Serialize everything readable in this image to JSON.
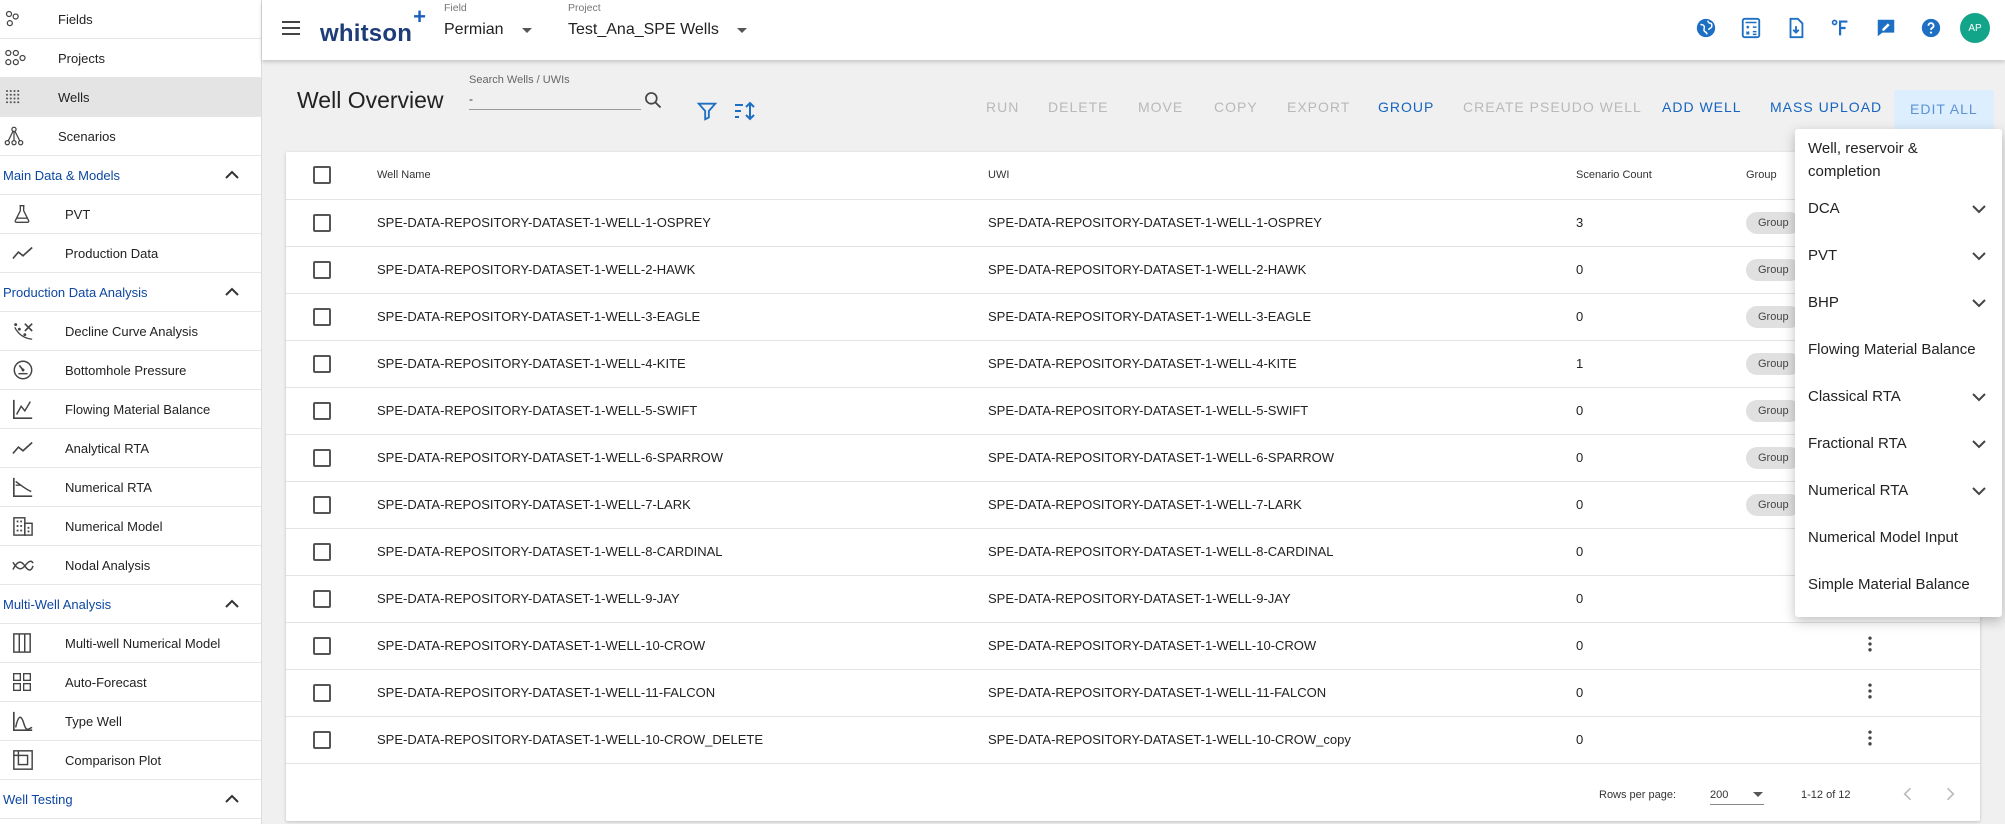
{
  "sidebar": {
    "top_items": [
      {
        "label": "Fields",
        "icon": "fields-icon"
      },
      {
        "label": "Projects",
        "icon": "projects-icon"
      },
      {
        "label": "Wells",
        "icon": "wells-icon",
        "active": true
      },
      {
        "label": "Scenarios",
        "icon": "scenarios-icon"
      }
    ],
    "sections": [
      {
        "title": "Main Data & Models",
        "items": [
          {
            "label": "PVT",
            "icon": "flask-icon"
          },
          {
            "label": "Production Data",
            "icon": "trend-line-icon"
          }
        ]
      },
      {
        "title": "Production Data Analysis",
        "items": [
          {
            "label": "Decline Curve Analysis",
            "icon": "decline-curve-icon"
          },
          {
            "label": "Bottomhole Pressure",
            "icon": "gauge-icon"
          },
          {
            "label": "Flowing Material Balance",
            "icon": "chart-icon"
          },
          {
            "label": "Analytical RTA",
            "icon": "trend-line-icon"
          },
          {
            "label": "Numerical RTA",
            "icon": "numerical-rta-icon"
          },
          {
            "label": "Numerical Model",
            "icon": "building-icon"
          },
          {
            "label": "Nodal Analysis",
            "icon": "nodal-icon"
          }
        ]
      },
      {
        "title": "Multi-Well Analysis",
        "items": [
          {
            "label": "Multi-well Numerical Model",
            "icon": "columns-icon"
          },
          {
            "label": "Auto-Forecast",
            "icon": "grid-icon"
          },
          {
            "label": "Type Well",
            "icon": "type-well-icon"
          },
          {
            "label": "Comparison Plot",
            "icon": "comparison-icon"
          }
        ]
      },
      {
        "title": "Well Testing",
        "items": []
      }
    ]
  },
  "topbar": {
    "brand": "whitson",
    "brand_plus": "+",
    "field_caption": "Field",
    "field_value": "Permian",
    "project_caption": "Project",
    "project_value": "Test_Ana_SPE Wells",
    "avatar_initials": "AP",
    "icons": [
      "globe-icon",
      "calculator-icon",
      "download-file-icon",
      "fahrenheit-icon",
      "feedback-icon",
      "help-icon"
    ]
  },
  "main": {
    "title": "Well Overview",
    "search_caption": "Search Wells / UWIs",
    "search_value": "-",
    "actions": [
      {
        "label": "RUN",
        "enabled": false
      },
      {
        "label": "DELETE",
        "enabled": false
      },
      {
        "label": "MOVE",
        "enabled": false
      },
      {
        "label": "COPY",
        "enabled": false
      },
      {
        "label": "EXPORT",
        "enabled": false
      },
      {
        "label": "GROUP",
        "enabled": true
      },
      {
        "label": "CREATE PSEUDO WELL",
        "enabled": false
      },
      {
        "label": "ADD WELL",
        "enabled": true
      },
      {
        "label": "MASS UPLOAD",
        "enabled": true
      },
      {
        "label": "EDIT ALL",
        "enabled": true
      }
    ]
  },
  "table": {
    "headers": {
      "name": "Well Name",
      "uwi": "UWI",
      "count": "Scenario Count",
      "group": "Group"
    },
    "rows": [
      {
        "name": "SPE-DATA-REPOSITORY-DATASET-1-WELL-1-OSPREY",
        "uwi": "SPE-DATA-REPOSITORY-DATASET-1-WELL-1-OSPREY",
        "count": "3",
        "group": "Group"
      },
      {
        "name": "SPE-DATA-REPOSITORY-DATASET-1-WELL-2-HAWK",
        "uwi": "SPE-DATA-REPOSITORY-DATASET-1-WELL-2-HAWK",
        "count": "0",
        "group": "Group"
      },
      {
        "name": "SPE-DATA-REPOSITORY-DATASET-1-WELL-3-EAGLE",
        "uwi": "SPE-DATA-REPOSITORY-DATASET-1-WELL-3-EAGLE",
        "count": "0",
        "group": "Group"
      },
      {
        "name": "SPE-DATA-REPOSITORY-DATASET-1-WELL-4-KITE",
        "uwi": "SPE-DATA-REPOSITORY-DATASET-1-WELL-4-KITE",
        "count": "1",
        "group": "Group"
      },
      {
        "name": "SPE-DATA-REPOSITORY-DATASET-1-WELL-5-SWIFT",
        "uwi": "SPE-DATA-REPOSITORY-DATASET-1-WELL-5-SWIFT",
        "count": "0",
        "group": "Group"
      },
      {
        "name": "SPE-DATA-REPOSITORY-DATASET-1-WELL-6-SPARROW",
        "uwi": "SPE-DATA-REPOSITORY-DATASET-1-WELL-6-SPARROW",
        "count": "0",
        "group": "Group"
      },
      {
        "name": "SPE-DATA-REPOSITORY-DATASET-1-WELL-7-LARK",
        "uwi": "SPE-DATA-REPOSITORY-DATASET-1-WELL-7-LARK",
        "count": "0",
        "group": "Group"
      },
      {
        "name": "SPE-DATA-REPOSITORY-DATASET-1-WELL-8-CARDINAL",
        "uwi": "SPE-DATA-REPOSITORY-DATASET-1-WELL-8-CARDINAL",
        "count": "0",
        "group": ""
      },
      {
        "name": "SPE-DATA-REPOSITORY-DATASET-1-WELL-9-JAY",
        "uwi": "SPE-DATA-REPOSITORY-DATASET-1-WELL-9-JAY",
        "count": "0",
        "group": ""
      },
      {
        "name": "SPE-DATA-REPOSITORY-DATASET-1-WELL-10-CROW",
        "uwi": "SPE-DATA-REPOSITORY-DATASET-1-WELL-10-CROW",
        "count": "0",
        "group": "",
        "menu": true
      },
      {
        "name": "SPE-DATA-REPOSITORY-DATASET-1-WELL-11-FALCON",
        "uwi": "SPE-DATA-REPOSITORY-DATASET-1-WELL-11-FALCON",
        "count": "0",
        "group": "",
        "menu": true
      },
      {
        "name": "SPE-DATA-REPOSITORY-DATASET-1-WELL-10-CROW_DELETE",
        "uwi": "SPE-DATA-REPOSITORY-DATASET-1-WELL-10-CROW_copy",
        "count": "0",
        "group": "",
        "menu": true
      }
    ]
  },
  "pager": {
    "rows_per_page_label": "Rows per page:",
    "rows_per_page_value": "200",
    "range": "1-12 of 12"
  },
  "dropdown": {
    "items": [
      {
        "label": "Well, reservoir & completion",
        "expandable": false
      },
      {
        "label": "DCA",
        "expandable": true
      },
      {
        "label": "PVT",
        "expandable": true
      },
      {
        "label": "BHP",
        "expandable": true
      },
      {
        "label": "Flowing Material Balance",
        "expandable": false
      },
      {
        "label": "Classical RTA",
        "expandable": true
      },
      {
        "label": "Fractional RTA",
        "expandable": true
      },
      {
        "label": "Numerical RTA",
        "expandable": true
      },
      {
        "label": "Numerical Model Input",
        "expandable": false
      },
      {
        "label": "Simple Material Balance",
        "expandable": false
      }
    ]
  },
  "colors": {
    "accent": "#1565c0",
    "section_title": "#0d47a1",
    "avatar_bg": "#13a58a",
    "disabled_action": "#b9b9b9",
    "edit_all_bg": "#ddeeff"
  }
}
